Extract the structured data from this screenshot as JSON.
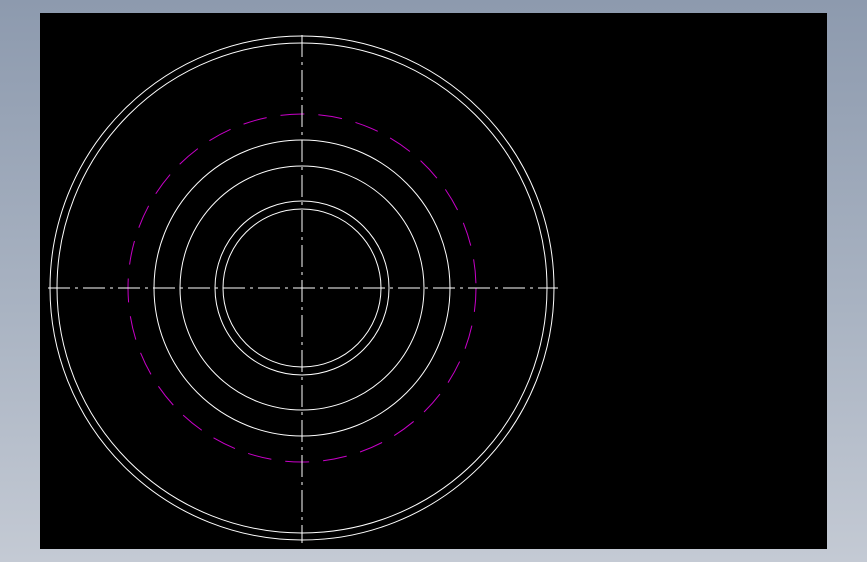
{
  "drawing": {
    "background_color": "#000000",
    "line_color": "#ffffff",
    "hidden_line_color": "#c800c8",
    "centerline_color": "#ffffff"
  }
}
